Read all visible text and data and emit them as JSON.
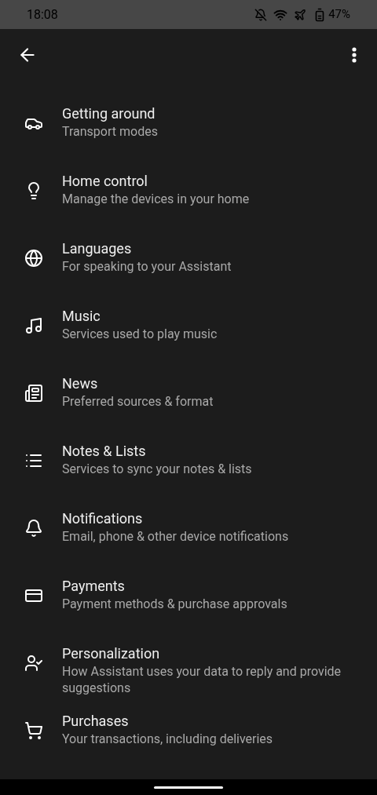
{
  "status_bar": {
    "time": "18:08",
    "battery": "47%"
  },
  "items": [
    {
      "title": "Getting around",
      "subtitle": "Transport modes"
    },
    {
      "title": "Home control",
      "subtitle": "Manage the devices in your home"
    },
    {
      "title": "Languages",
      "subtitle": "For speaking to your Assistant"
    },
    {
      "title": "Music",
      "subtitle": "Services used to play music"
    },
    {
      "title": "News",
      "subtitle": "Preferred sources & format"
    },
    {
      "title": "Notes & Lists",
      "subtitle": "Services to sync your notes & lists"
    },
    {
      "title": "Notifications",
      "subtitle": "Email, phone & other device notifications"
    },
    {
      "title": "Payments",
      "subtitle": "Payment methods & purchase approvals"
    },
    {
      "title": "Personalization",
      "subtitle": "How Assistant uses your data to reply and provide suggestions"
    },
    {
      "title": "Purchases",
      "subtitle": "Your transactions, including deliveries"
    }
  ]
}
